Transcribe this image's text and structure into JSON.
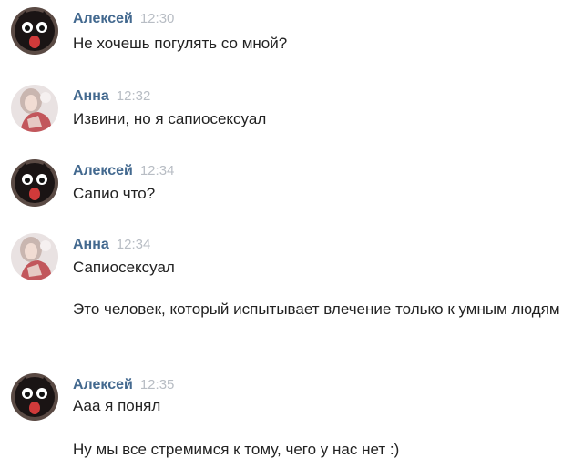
{
  "messages": [
    {
      "author": "Алексей",
      "time": "12:30",
      "avatar": "cat-avatar-icon",
      "lines": [
        "Не хочешь погулять со мной?"
      ]
    },
    {
      "author": "Анна",
      "time": "12:32",
      "avatar": "girl-avatar-icon",
      "lines": [
        "Извини, но я сапиосексуал"
      ]
    },
    {
      "author": "Алексей",
      "time": "12:34",
      "avatar": "cat-avatar-icon",
      "lines": [
        "Сапио что?"
      ]
    },
    {
      "author": "Анна",
      "time": "12:34",
      "avatar": "girl-avatar-icon",
      "lines": [
        "Сапиосексуал",
        "Это человек, который испытывает влечение только к умным людям"
      ]
    },
    {
      "author": "Алексей",
      "time": "12:35",
      "avatar": "cat-avatar-icon",
      "lines": [
        "Ааа я понял",
        "Ну мы все стремимся к тому, чего у нас нет :)"
      ]
    }
  ],
  "colors": {
    "author": "#43698f",
    "time": "#b8bdc4",
    "text": "#222222",
    "background": "#ffffff"
  }
}
